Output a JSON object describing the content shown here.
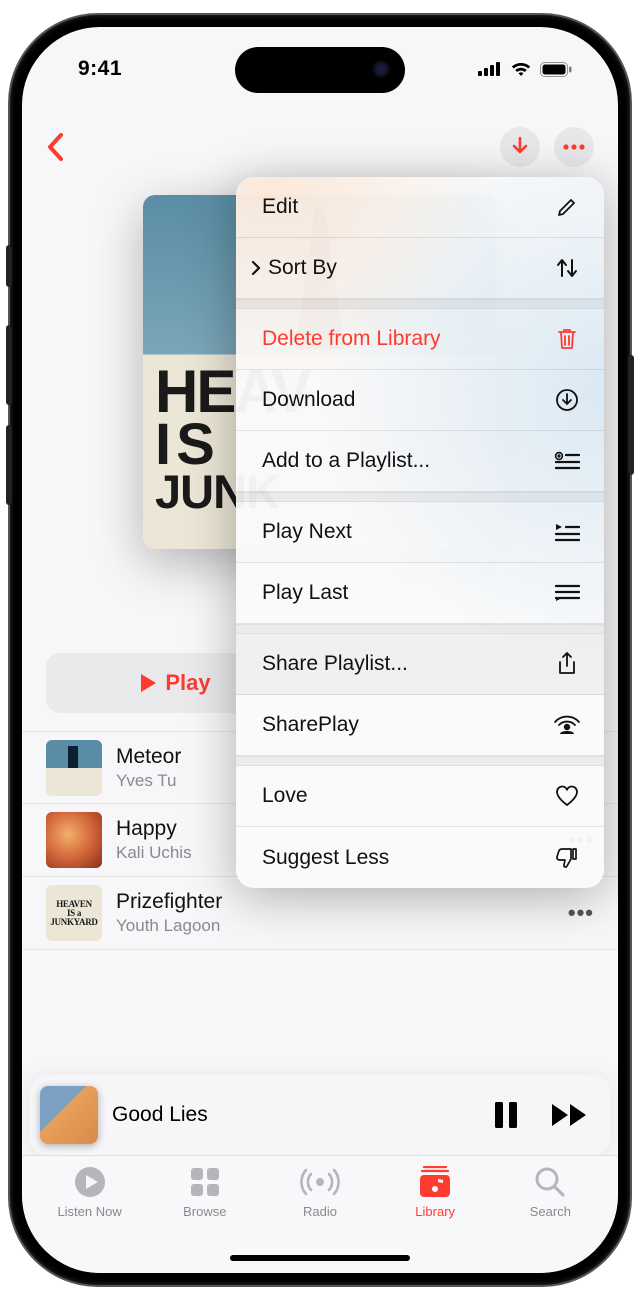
{
  "status": {
    "time": "9:41"
  },
  "art": {
    "line1": "HEAV",
    "line2": "IS",
    "line3": "JUNK"
  },
  "thumb3_lines": [
    "HEAVEN",
    "IS a",
    "JUNKYARD"
  ],
  "play_button": "Play",
  "tracks": [
    {
      "title": "Meteor",
      "artist": "Yves Tu"
    },
    {
      "title": "Happy ",
      "artist": "Kali Uchis"
    },
    {
      "title": "Prizefighter",
      "artist": "Youth Lagoon"
    }
  ],
  "now_playing": {
    "title": "Good Lies"
  },
  "tabs": {
    "listen": "Listen Now",
    "browse": "Browse",
    "radio": "Radio",
    "library": "Library",
    "search": "Search"
  },
  "menu": {
    "edit": "Edit",
    "sort": "Sort By",
    "delete": "Delete from Library",
    "download": "Download",
    "add": "Add to a Playlist...",
    "next": "Play Next",
    "last": "Play Last",
    "share": "Share Playlist...",
    "shareplay": "SharePlay",
    "love": "Love",
    "suggest": "Suggest Less"
  }
}
